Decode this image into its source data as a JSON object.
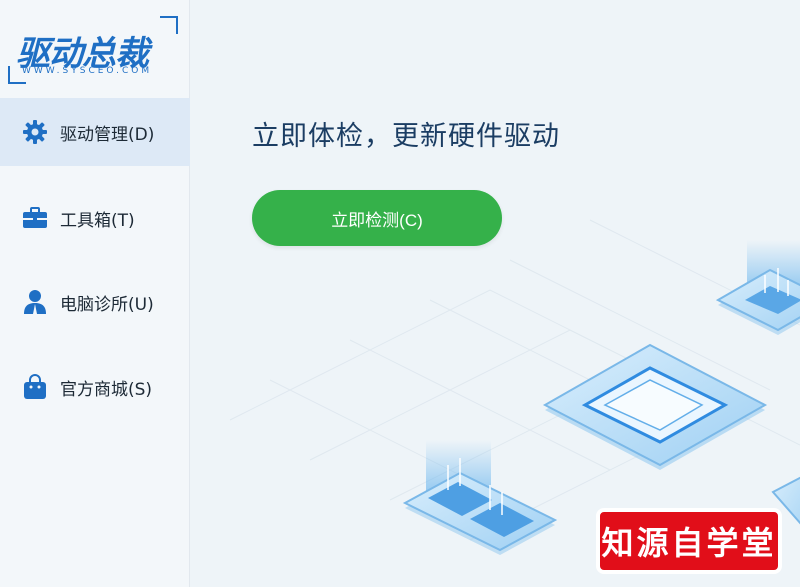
{
  "app": {
    "logo_text": "驱动总裁",
    "logo_url": "WWW.SYSCEO.COM"
  },
  "sidebar": {
    "items": [
      {
        "label": "驱动管理(D)",
        "icon": "gear-icon",
        "active": true
      },
      {
        "label": "工具箱(T)",
        "icon": "toolbox-icon",
        "active": false
      },
      {
        "label": "电脑诊所(U)",
        "icon": "user-icon",
        "active": false
      },
      {
        "label": "官方商城(S)",
        "icon": "shopping-bag-icon",
        "active": false
      }
    ]
  },
  "main": {
    "title": "立即体检，更新硬件驱动",
    "scan_button": "立即检测(C)"
  },
  "watermark": {
    "text": "知源自学堂"
  },
  "colors": {
    "accent": "#1f6fc4",
    "button": "#35b14a",
    "active_bg": "#dde9f6",
    "watermark_bg": "#e10e19"
  }
}
